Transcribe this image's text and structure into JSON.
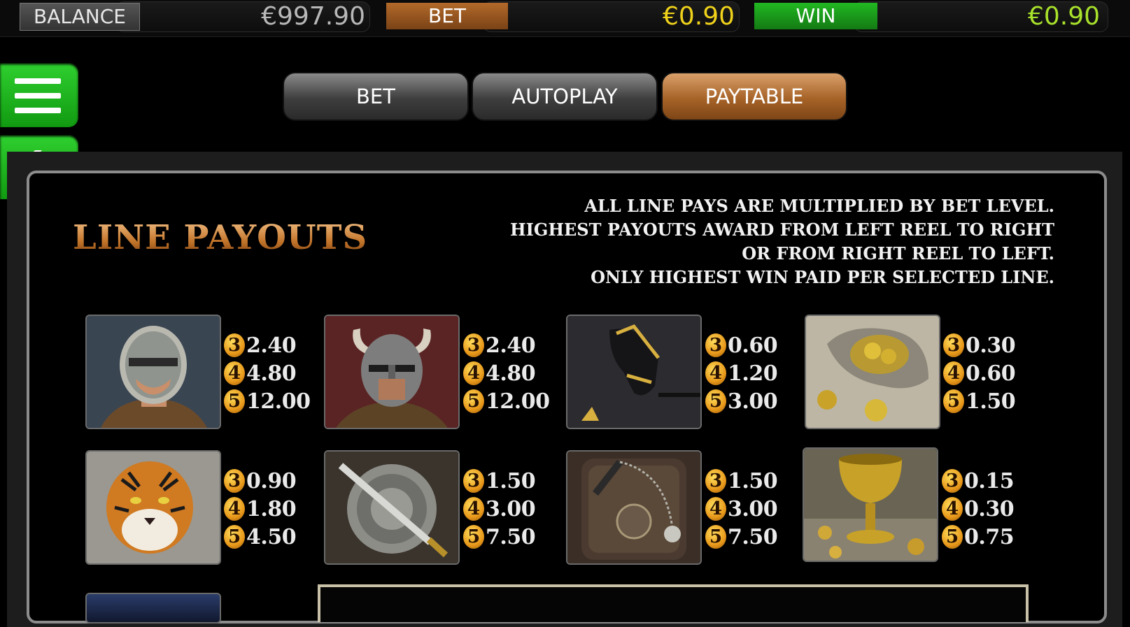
{
  "topbar": {
    "balance_label": "BALANCE",
    "balance_value": "€997.90",
    "bet_label": "BET",
    "bet_value": "€0.90",
    "win_label": "WIN",
    "win_value": "€0.90"
  },
  "tabs": [
    {
      "label": "BET"
    },
    {
      "label": "AUTOPLAY"
    },
    {
      "label": "PAYTABLE"
    }
  ],
  "paytable": {
    "title": "LINE PAYOUTS",
    "notes": [
      "ALL LINE PAYS ARE MULTIPLIED BY BET LEVEL.",
      "HIGHEST PAYOUTS AWARD FROM LEFT REEL TO RIGHT",
      "OR FROM RIGHT REEL TO LEFT.",
      "ONLY HIGHEST WIN PAID PER SELECTED LINE."
    ],
    "symbols": [
      {
        "icon": "masked-gladiator-symbol",
        "pays": [
          {
            "count": "3",
            "amount": "2.40"
          },
          {
            "count": "4",
            "amount": "4.80"
          },
          {
            "count": "5",
            "amount": "12.00"
          }
        ]
      },
      {
        "icon": "horned-helmet-warrior-symbol",
        "pays": [
          {
            "count": "3",
            "amount": "2.40"
          },
          {
            "count": "4",
            "amount": "4.80"
          },
          {
            "count": "5",
            "amount": "12.00"
          }
        ]
      },
      {
        "icon": "horse-symbol",
        "pays": [
          {
            "count": "3",
            "amount": "0.60"
          },
          {
            "count": "4",
            "amount": "1.20"
          },
          {
            "count": "5",
            "amount": "3.00"
          }
        ]
      },
      {
        "icon": "coin-bag-symbol",
        "pays": [
          {
            "count": "3",
            "amount": "0.30"
          },
          {
            "count": "4",
            "amount": "0.60"
          },
          {
            "count": "5",
            "amount": "1.50"
          }
        ]
      },
      {
        "icon": "tiger-symbol",
        "pays": [
          {
            "count": "3",
            "amount": "0.90"
          },
          {
            "count": "4",
            "amount": "1.80"
          },
          {
            "count": "5",
            "amount": "4.50"
          }
        ]
      },
      {
        "icon": "sword-shield-symbol",
        "pays": [
          {
            "count": "3",
            "amount": "1.50"
          },
          {
            "count": "4",
            "amount": "3.00"
          },
          {
            "count": "5",
            "amount": "7.50"
          }
        ]
      },
      {
        "icon": "flail-shield-symbol",
        "pays": [
          {
            "count": "3",
            "amount": "1.50"
          },
          {
            "count": "4",
            "amount": "3.00"
          },
          {
            "count": "5",
            "amount": "7.50"
          }
        ]
      },
      {
        "icon": "golden-chalice-symbol",
        "pays": [
          {
            "count": "3",
            "amount": "0.15"
          },
          {
            "count": "4",
            "amount": "0.30"
          },
          {
            "count": "5",
            "amount": "0.75"
          }
        ]
      }
    ]
  }
}
